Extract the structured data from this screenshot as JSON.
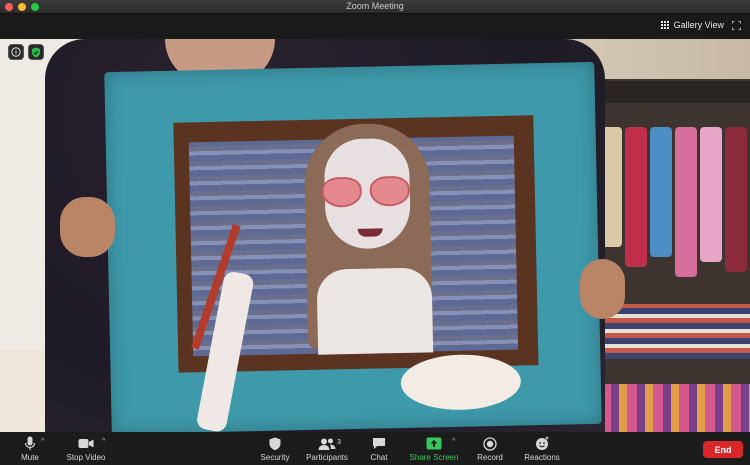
{
  "window": {
    "title": "Zoom Meeting"
  },
  "header": {
    "gallery_view_label": "Gallery View"
  },
  "toolbar": {
    "mute_label": "Mute",
    "stop_video_label": "Stop Video",
    "security_label": "Security",
    "participants_label": "Participants",
    "participants_count": "3",
    "chat_label": "Chat",
    "share_screen_label": "Share Screen",
    "record_label": "Record",
    "reactions_label": "Reactions",
    "end_label": "End"
  },
  "colors": {
    "share_green": "#36c85a",
    "end_red": "#d8262b",
    "toolbar_bg": "#1c1c1c"
  },
  "icons": [
    "info-icon",
    "security-shield-icon",
    "gallery-grid-icon",
    "fullscreen-icon",
    "microphone-icon",
    "video-camera-icon",
    "shield-icon",
    "participants-icon",
    "chat-bubble-icon",
    "share-screen-icon",
    "record-icon",
    "reactions-icon"
  ]
}
